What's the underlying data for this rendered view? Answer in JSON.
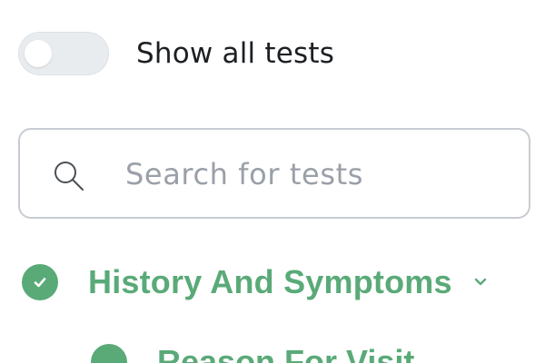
{
  "filter": {
    "toggle_label": "Show all tests",
    "toggle_on": false
  },
  "search": {
    "placeholder": "Search for tests",
    "value": ""
  },
  "sections": [
    {
      "title": "History And Symptoms",
      "status": "complete",
      "expanded": true,
      "items": [
        {
          "title": "Reason For Visit",
          "status": "complete"
        }
      ]
    }
  ],
  "colors": {
    "accent": "#5aaa78",
    "text": "#1c1f23",
    "placeholder": "#9aa0a8",
    "border": "#c8ccd2"
  }
}
